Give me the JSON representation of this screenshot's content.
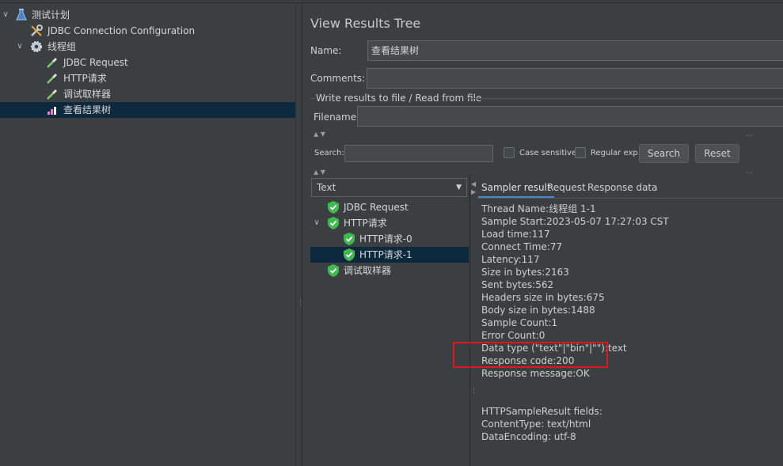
{
  "tree": {
    "items": [
      {
        "label": "测试计划",
        "icon": "flask-icon"
      },
      {
        "label": "JDBC Connection Configuration",
        "icon": "wrench-icon"
      },
      {
        "label": "线程组",
        "icon": "gear-icon"
      },
      {
        "label": "JDBC Request",
        "icon": "pipette-icon"
      },
      {
        "label": "HTTP请求",
        "icon": "pipette-icon"
      },
      {
        "label": "调试取样器",
        "icon": "pipette-icon"
      },
      {
        "label": "查看结果树",
        "icon": "chart-icon"
      }
    ]
  },
  "panel": {
    "title": "View Results Tree",
    "name_label": "Name:",
    "name_value": "查看结果树",
    "comments_label": "Comments:",
    "comments_value": "",
    "write_group_label": "Write results to file / Read from file",
    "filename_label": "Filename",
    "filename_value": "",
    "search_label": "Search:",
    "search_value": "",
    "case_sensitive_label": "Case sensitive",
    "regular_exp_label": "Regular exp.",
    "search_button": "Search",
    "reset_button": "Reset"
  },
  "results": {
    "renderer": "Text",
    "samples": [
      {
        "label": "JDBC Request"
      },
      {
        "label": "HTTP请求"
      },
      {
        "label": "HTTP请求-0"
      },
      {
        "label": "HTTP请求-1"
      },
      {
        "label": "调试取样器"
      }
    ]
  },
  "tabs": [
    "Sampler result",
    "Request",
    "Response data"
  ],
  "sampler_result": [
    "Thread Name:线程组 1-1",
    "Sample Start:2023-05-07 17:27:03 CST",
    "Load time:117",
    "Connect Time:77",
    "Latency:117",
    "Size in bytes:2163",
    "Sent bytes:562",
    "Headers size in bytes:675",
    "Body size in bytes:1488",
    "Sample Count:1",
    "Error Count:0",
    "Data type (\"text\"|\"bin\"|\"\"):text",
    "Response code:200",
    "Response message:OK",
    "",
    "",
    "HTTPSampleResult fields:",
    "ContentType: text/html",
    "DataEncoding: utf-8"
  ],
  "colors": {
    "background": "#3c3f41",
    "selection": "#0d293e",
    "highlight_box": "#e0161c",
    "success_shield": "#3fb950"
  }
}
